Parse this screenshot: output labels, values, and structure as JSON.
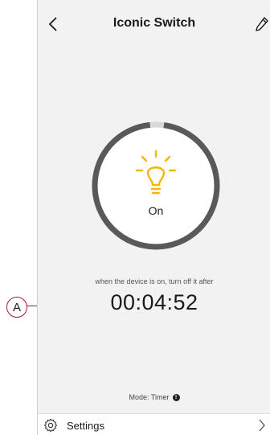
{
  "header": {
    "title": "Iconic Switch",
    "back_icon": "chevron-left-icon",
    "edit_icon": "pencil-icon"
  },
  "dial": {
    "state_label": "On",
    "icon": "lightbulb-icon",
    "bulb_color": "#f2b705",
    "ring_color": "#58595b"
  },
  "timer": {
    "hint": "when the device is on, turn off it after",
    "value": "00:04:52"
  },
  "mode": {
    "label": "Mode: Timer",
    "info_glyph": "!"
  },
  "settings": {
    "label": "Settings",
    "icon": "gear-icon",
    "chevron_icon": "chevron-right-icon"
  },
  "annotation": {
    "label": "A",
    "color": "#a3174c"
  }
}
